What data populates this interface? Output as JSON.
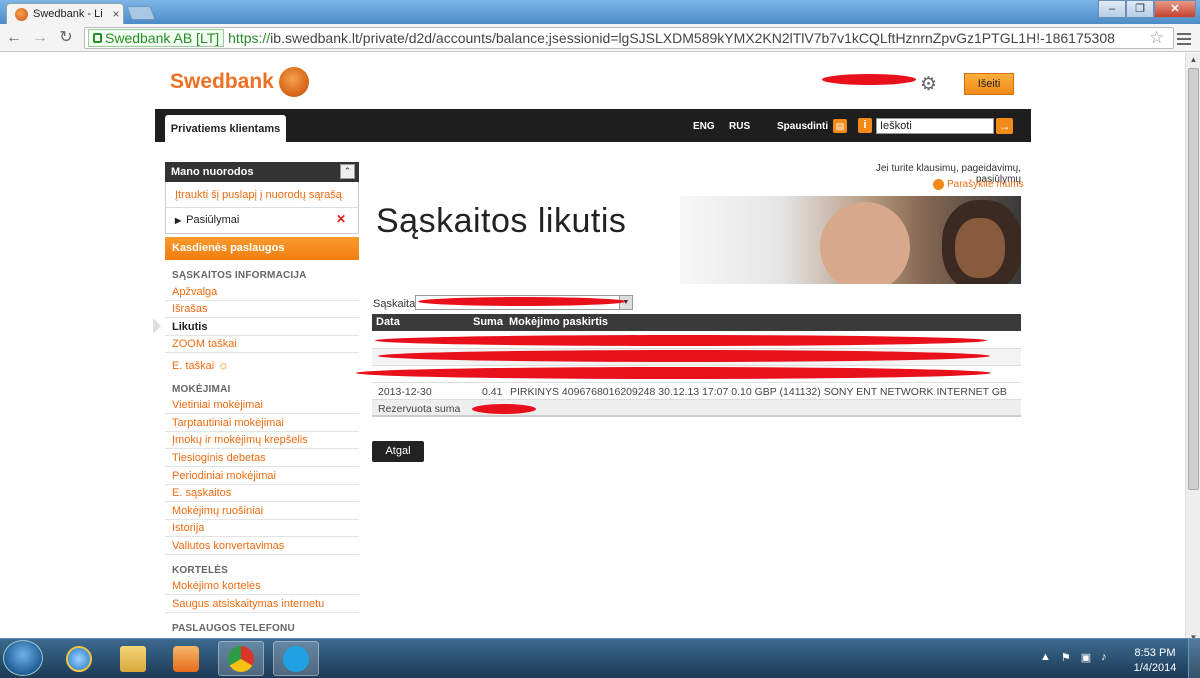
{
  "browser": {
    "tab_title": "Swedbank - Li",
    "tab_close": "×",
    "window_buttons": [
      "–",
      "❐",
      "✕"
    ],
    "ev_label": "Swedbank AB [LT]",
    "url_scheme": "https://",
    "url_rest": "ib.swedbank.lt/private/d2d/accounts/balance;jsessionid=lgSJSLXDM589kYMX2KN2lTlV7b7v1kCQLftHznrnZpvGz1PTGL1H!-186175308",
    "nav_back": "←",
    "nav_forward": "→",
    "nav_reload": "↻",
    "star": "☆"
  },
  "header": {
    "logo_text": "Swedbank",
    "logout_label": "Išeiti"
  },
  "topnav": {
    "tab_label": "Privatiems klientams",
    "lang_eng": "ENG",
    "lang_rus": "RUS",
    "print_label": "Spausdinti",
    "info_label": "i",
    "search_value": "Ieškoti",
    "search_go": "→"
  },
  "sidebar": {
    "shortcuts_title": "Mano nuorodos",
    "collapse": "⌃",
    "add_link": "Įtraukti šį puslapį į nuorodų sąrašą",
    "suggestions_label": "Pasiūlymai",
    "suggestions_bullet": "▶",
    "remove": "✕",
    "daily_services": "Kasdienės paslaugos",
    "sections": [
      {
        "title": "SĄSKAITOS INFORMACIJA",
        "items": [
          "Apžvalga",
          "Išrašas",
          "Likutis",
          "ZOOM taškai",
          "E. taškai"
        ]
      },
      {
        "title": "MOKĖJIMAI",
        "items": [
          "Vietiniai mokėjimai",
          "Tarptautiniai mokėjimai",
          "Įmokų ir mokėjimų krepšelis",
          "Tiesioginis debetas",
          "Periodiniai mokėjimai",
          "E. sąskaitos",
          "Mokėjimų ruošiniai",
          "Istorija",
          "Valiutos konvertavimas"
        ]
      },
      {
        "title": "KORTELĖS",
        "items": [
          "Mokėjimo kortelės",
          "Saugus atsiskaitymas internetu"
        ]
      },
      {
        "title": "PASLAUGOS TELEFONU",
        "items": []
      }
    ],
    "active_item": "Likutis",
    "etaskai_icon": "☼"
  },
  "main": {
    "contact_text": "Jei turite klausimų, pageidavimų, pasiūlymų",
    "write_us": "Parašykite mums",
    "page_title": "Sąskaitos likutis",
    "account_label": "Sąskaita",
    "select_arrow": "▼",
    "table": {
      "columns": [
        "Data",
        "Suma",
        "Mokėjimo paskirtis"
      ],
      "rows": [
        {
          "date": "2013-12-30",
          "amount": "0.41",
          "purpose": "PIRKINYS 4096768016209248 30.12.13 17:07 0.10 GBP (141132) SONY ENT NETWORK INTERNET GB"
        }
      ],
      "reserved_label": "Rezervuota suma"
    },
    "back_button": "Atgal"
  },
  "taskbar": {
    "time": "8:53 PM",
    "date": "1/4/2014"
  },
  "colors": {
    "accent": "#ee7023",
    "nav_dark": "#1e1e1e",
    "redaction": "#e8101a"
  }
}
